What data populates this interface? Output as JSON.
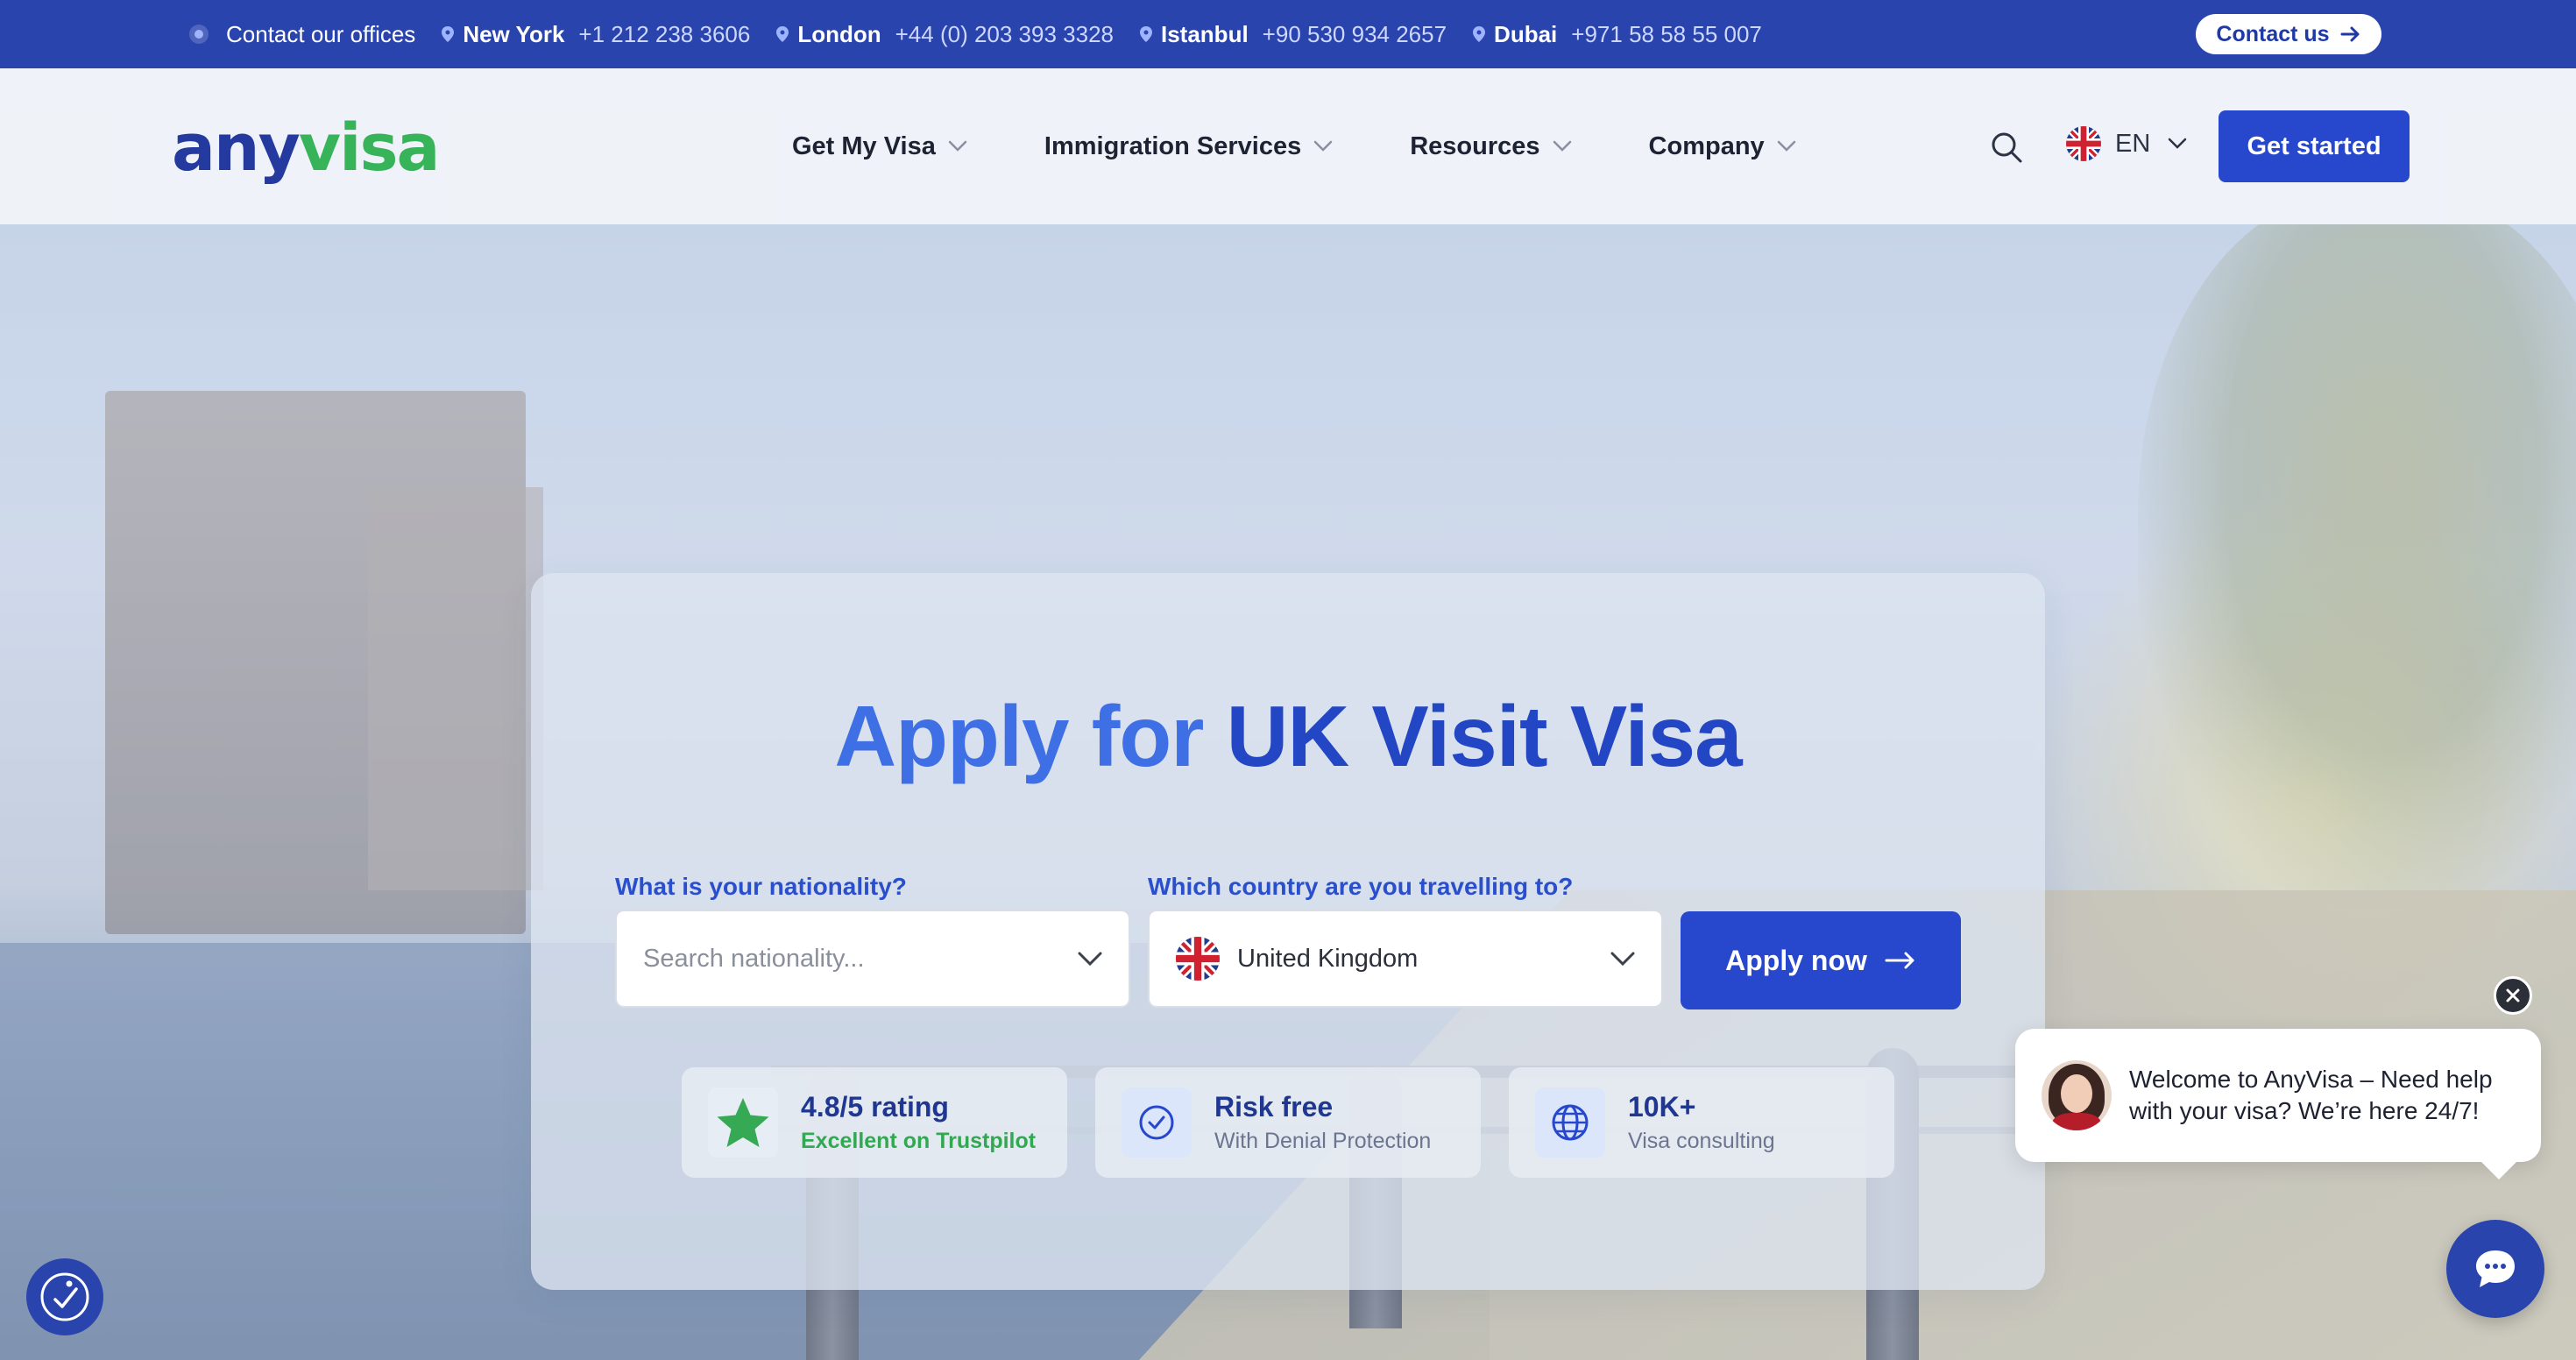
{
  "topbar": {
    "offices_label": "Contact our offices",
    "offices": [
      {
        "city": "New York",
        "phone": "+1 212 238 3606"
      },
      {
        "city": "London",
        "phone": "+44 (0) 203 393 3328"
      },
      {
        "city": "Istanbul",
        "phone": "+90 530 934 2657"
      },
      {
        "city": "Dubai",
        "phone": "+971 58 58 55 007"
      }
    ],
    "contact_label": "Contact us"
  },
  "header": {
    "logo_part1": "any",
    "logo_part2": "visa",
    "nav": [
      "Get My Visa",
      "Immigration Services",
      "Resources",
      "Company"
    ],
    "language": "EN",
    "cta_label": "Get started"
  },
  "hero": {
    "title_part1": "Apply for",
    "title_part2": "UK Visit Visa",
    "nationality_label": "What is your nationality?",
    "nationality_placeholder": "Search nationality...",
    "destination_label": "Which country are you travelling to?",
    "destination_value": "United Kingdom",
    "apply_label": "Apply now",
    "stats": [
      {
        "main": "4.8/5 rating",
        "sub": "Excellent on Trustpilot",
        "icon": "star-icon"
      },
      {
        "main": "Risk free",
        "sub": "With Denial Protection",
        "icon": "check-circle-icon"
      },
      {
        "main": "10K+",
        "sub": "Visa consulting",
        "icon": "globe-icon"
      }
    ]
  },
  "chat": {
    "message": "Welcome to AnyVisa – Need help with your visa? We’re here 24/7!"
  },
  "colors": {
    "brand_blue": "#2747cc",
    "topbar_blue": "#2a44ae",
    "brand_green": "#37b35a",
    "title_light_blue": "#3f6fe4"
  }
}
